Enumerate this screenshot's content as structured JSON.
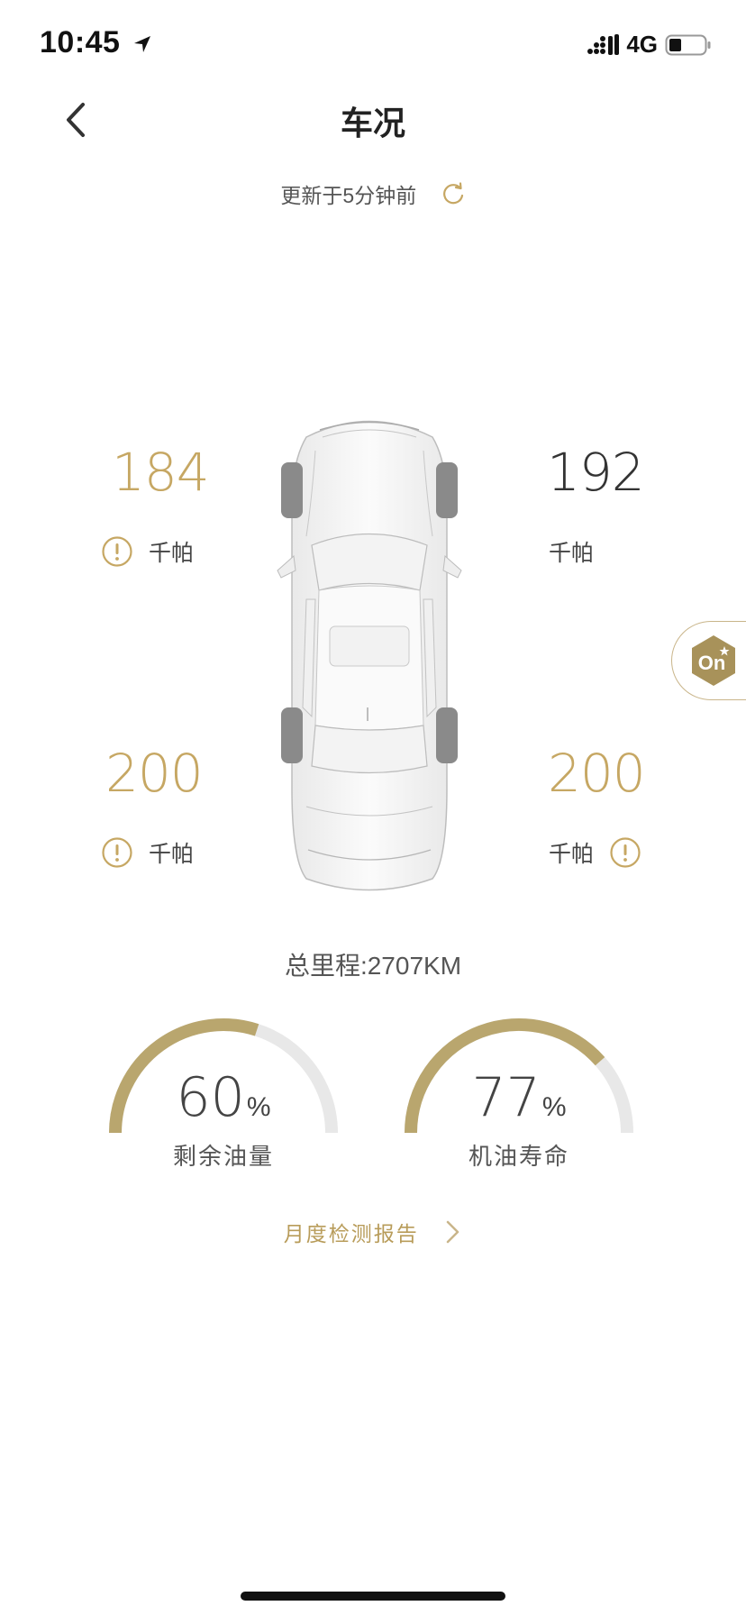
{
  "status_bar": {
    "time": "10:45",
    "network": "4G"
  },
  "header": {
    "title": "车况",
    "updated": "更新于5分钟前"
  },
  "tires": {
    "front_left": {
      "value": "184",
      "unit": "千帕"
    },
    "front_right": {
      "value": "192",
      "unit": "千帕"
    },
    "rear_left": {
      "value": "200",
      "unit": "千帕"
    },
    "rear_right": {
      "value": "200",
      "unit": "千帕"
    }
  },
  "side_tab": {
    "label": "On"
  },
  "mileage": "总里程:2707KM",
  "gauges": [
    {
      "value": "60",
      "percent": 60,
      "symbol": "%",
      "label": "剩余油量"
    },
    {
      "value": "77",
      "percent": 77,
      "symbol": "%",
      "label": "机油寿命"
    }
  ],
  "report": {
    "label": "月度检测报告"
  },
  "colors": {
    "accent": "#c6a763",
    "gauge_fill": "#b9a66e",
    "gauge_track": "#e8e8e8"
  }
}
